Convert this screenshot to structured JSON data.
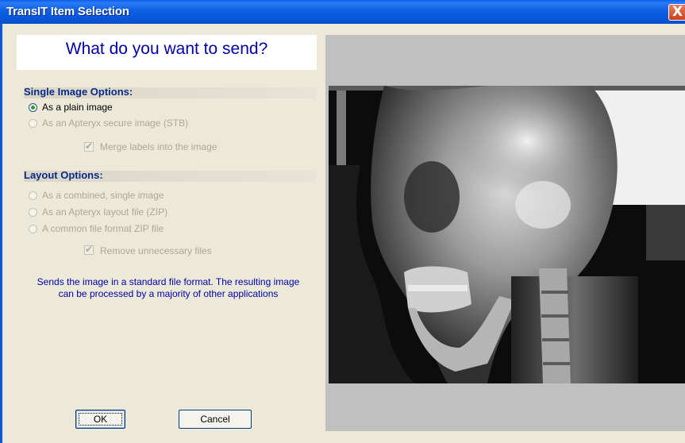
{
  "window": {
    "title": "TransIT Item Selection",
    "close_label": "X"
  },
  "header": {
    "question": "What do you want to send?"
  },
  "single_image_options": {
    "title": "Single Image Options:",
    "options": [
      {
        "label": "As a plain image",
        "selected": true,
        "enabled": true
      },
      {
        "label": "As an Apteryx secure image (STB)",
        "selected": false,
        "enabled": false
      }
    ],
    "merge_labels": {
      "label": "Merge labels into the image",
      "checked": true,
      "enabled": false
    }
  },
  "layout_options": {
    "title": "Layout Options:",
    "options": [
      {
        "label": "As a combined, single image",
        "selected": false,
        "enabled": false
      },
      {
        "label": "As an Apteryx layout file (ZIP)",
        "selected": false,
        "enabled": false
      },
      {
        "label": "A common file format ZIP file",
        "selected": false,
        "enabled": false
      }
    ],
    "remove_files": {
      "label": "Remove unnecessary files",
      "checked": true,
      "enabled": false
    }
  },
  "description": {
    "line1": "Sends the image in a standard file format.  The resulting image",
    "line2": "can be processed by a majority of other applications"
  },
  "buttons": {
    "ok": "OK",
    "cancel": "Cancel"
  },
  "preview": {
    "image_icon": "cephalometric-xray-image"
  },
  "colors": {
    "titlebar": "#0a55d9",
    "header_text": "#0000a8",
    "section_title": "#0a2a88",
    "disabled_text": "#aca899",
    "dialog_bg": "#ece9d8",
    "preview_bg": "#c0c0c0"
  }
}
